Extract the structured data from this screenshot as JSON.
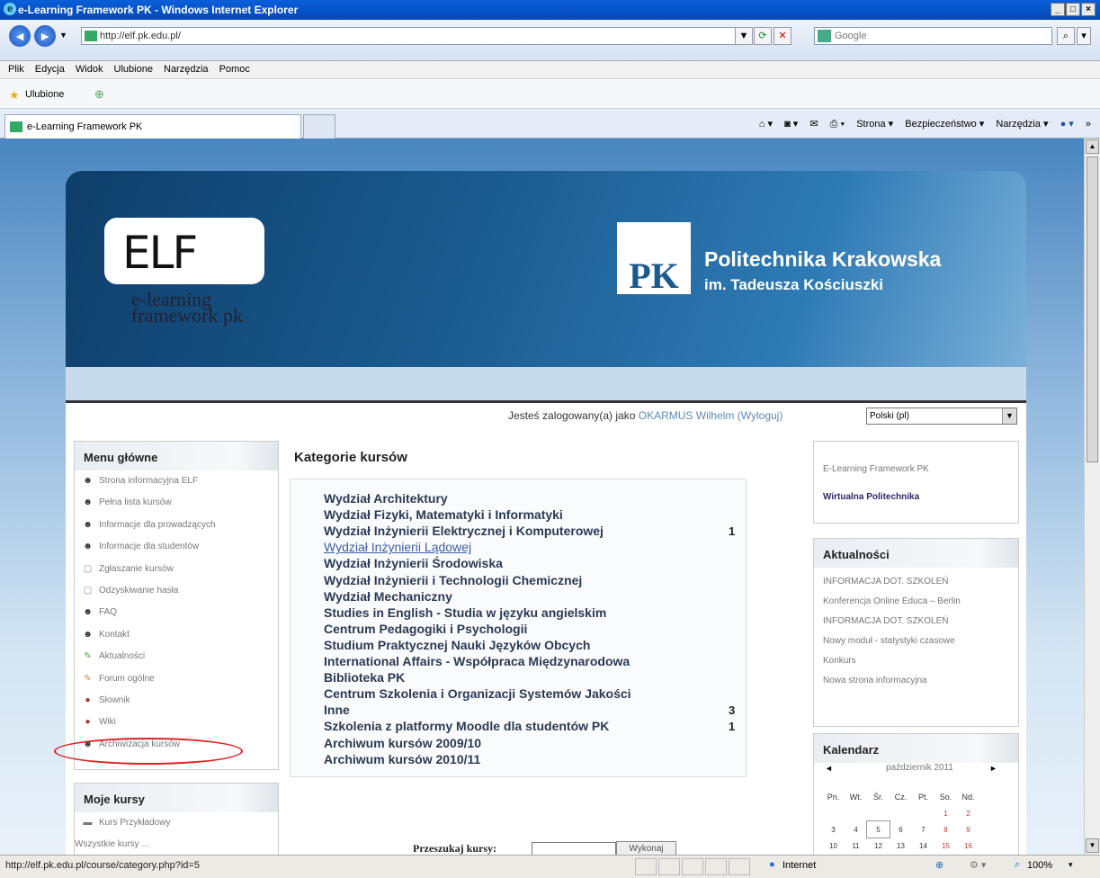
{
  "window": {
    "title": "e-Learning Framework PK - Windows Internet Explorer",
    "min": "_",
    "max": "□",
    "close": "×"
  },
  "toolbar": {
    "url": "http://elf.pk.edu.pl/",
    "search_placeholder": "Google",
    "back": "◄",
    "forward": "►"
  },
  "menubar": [
    "Plik",
    "Edycja",
    "Widok",
    "Ulubione",
    "Narzędzia",
    "Pomoc"
  ],
  "favorites": {
    "label": "Ulubione"
  },
  "tabs": {
    "active": "e-Learning Framework PK",
    "commands": [
      "Strona ▾",
      "Bezpieczeństwo ▾",
      "Narzędzia ▾"
    ]
  },
  "header": {
    "elf_logo": "ELF",
    "elf_sub1": "e-learning",
    "elf_sub2": "framework pk",
    "pk_logo": "PK",
    "uni_name": "Politechnika Krakowska",
    "uni_sub": "im. Tadeusza Kościuszki"
  },
  "login": {
    "prefix": "Jesteś zalogowany(a) jako ",
    "user": "OKARMUS Wilhelm",
    "logout": "(Wyloguj)",
    "language": "Polski (pl)"
  },
  "main_menu": {
    "title": "Menu główne",
    "items": [
      {
        "label": "Strona informacyjna ELF",
        "icon": "☻"
      },
      {
        "label": "Pełna lista kursów",
        "icon": "☻"
      },
      {
        "label": "Informacje dla prowadzących",
        "icon": "☻"
      },
      {
        "label": "Informacje dla studentów",
        "icon": "☻"
      },
      {
        "label": "Zgłaszanie kursów",
        "icon": "▢"
      },
      {
        "label": "Odzyskiwanie hasła",
        "icon": "▢"
      },
      {
        "label": "FAQ",
        "icon": "☻"
      },
      {
        "label": "Kontakt",
        "icon": "☻"
      },
      {
        "label": "Aktualności",
        "icon": "✎"
      },
      {
        "label": "Forum ogólne",
        "icon": "✎"
      },
      {
        "label": "Słownik",
        "icon": "●"
      },
      {
        "label": "Wiki",
        "icon": "●"
      },
      {
        "label": "Archiwizacja kursów",
        "icon": "☻"
      }
    ]
  },
  "my_courses": {
    "title": "Moje kursy",
    "items": [
      "Kurs Przykładowy"
    ],
    "all": "Wszystkie kursy ..."
  },
  "categories": {
    "title": "Kategorie kursów",
    "items": [
      {
        "name": "Wydział Architektury",
        "count": ""
      },
      {
        "name": "Wydział Fizyki, Matematyki i Informatyki",
        "count": ""
      },
      {
        "name": "Wydział Inżynierii Elektrycznej i Komputerowej",
        "count": "1"
      },
      {
        "name": "Wydział Inżynierii Lądowej",
        "count": ""
      },
      {
        "name": "Wydział Inżynierii Środowiska",
        "count": ""
      },
      {
        "name": "Wydział Inżynierii i Technologii Chemicznej",
        "count": ""
      },
      {
        "name": "Wydział Mechaniczny",
        "count": ""
      },
      {
        "name": "Studies in English - Studia w języku angielskim",
        "count": ""
      },
      {
        "name": "Centrum Pedagogiki i Psychologii",
        "count": ""
      },
      {
        "name": "Studium Praktycznej Nauki Języków Obcych",
        "count": ""
      },
      {
        "name": "International Affairs - Współpraca Międzynarodowa",
        "count": ""
      },
      {
        "name": "Biblioteka PK",
        "count": ""
      },
      {
        "name": "Centrum Szkolenia i Organizacji Systemów Jakości",
        "count": ""
      },
      {
        "name": "Inne",
        "count": "3"
      },
      {
        "name": "Szkolenia z platformy Moodle dla studentów PK",
        "count": "1"
      },
      {
        "name": "Archiwum kursów 2009/10",
        "count": ""
      },
      {
        "name": "Archiwum kursów 2010/11",
        "count": ""
      }
    ],
    "search_label": "Przeszukaj kursy:",
    "search_button": "Wykonaj"
  },
  "right_links": {
    "items": [
      "E-Learning Framework PK",
      "Wirtualna Politechnika"
    ]
  },
  "news": {
    "title": "Aktualności",
    "items": [
      "INFORMACJA DOT. SZKOLEŃ",
      "Konferencja Online Educa – Berlin",
      "INFORMACJA DOT. SZKOLEŃ",
      "Nowy moduł - statystyki czasowe",
      "Konkurs",
      "Nowa strona informacyjna"
    ]
  },
  "calendar": {
    "title": "Kalendarz",
    "month": "październik 2011",
    "prev": "◄",
    "next": "►",
    "days": [
      "Pn.",
      "Wt.",
      "Śr.",
      "Cz.",
      "Pt.",
      "So.",
      "Nd."
    ],
    "rows": [
      [
        "",
        "",
        "",
        "",
        "",
        "1",
        "2"
      ],
      [
        "3",
        "4",
        "5",
        "6",
        "7",
        "8",
        "9"
      ],
      [
        "10",
        "11",
        "12",
        "13",
        "14",
        "15",
        "16"
      ]
    ]
  },
  "status": {
    "url": "http://elf.pk.edu.pl/course/category.php?id=5",
    "zone": "Internet",
    "zoom": "100%"
  }
}
